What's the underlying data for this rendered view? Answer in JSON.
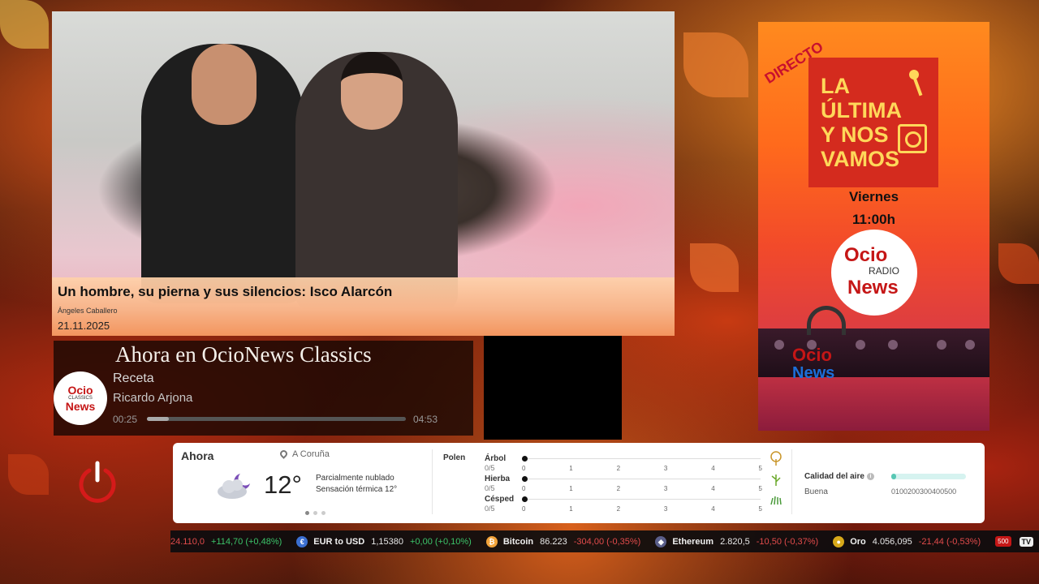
{
  "featured": {
    "title": "Un hombre, su pierna y sus silencios: Isco Alarcón",
    "author": "Ángeles Caballero",
    "date": "21.11.2025"
  },
  "player": {
    "heading": "Ahora en OcioNews Classics",
    "logo": {
      "top": "Ocio",
      "middle": "CLASSICS",
      "bottom": "News"
    },
    "song": "Receta",
    "artist": "Ricardo Arjona",
    "elapsed": "00:25",
    "duration": "04:53",
    "progress": 0.085
  },
  "radio": {
    "badge": "DIRECTO",
    "show_lines": [
      "LA",
      "ÚLTIMA",
      "Y NOS",
      "VAMOS"
    ],
    "day": "Viernes",
    "time": "11:00h",
    "logo": {
      "top": "Ocio",
      "middle": "RADIO",
      "bottom": "News"
    },
    "corner_logo": {
      "top": "Ocio",
      "bottom": "News"
    }
  },
  "weather": {
    "now_label": "Ahora",
    "location": "A Coruña",
    "temp": "12°",
    "condition": "Parcialmente nublado",
    "feels_like": "Sensación térmica 12°",
    "icon": "partly-cloudy-night-icon",
    "pollen_label": "Polen",
    "pollen": [
      {
        "name": "Árbol",
        "score": "0/5",
        "level": 0,
        "icon": "tree-icon"
      },
      {
        "name": "Hierba",
        "score": "0/5",
        "level": 0,
        "icon": "grass-icon"
      },
      {
        "name": "Césped",
        "score": "0/5",
        "level": 0,
        "icon": "lawn-icon"
      }
    ],
    "pollen_ticks": [
      "0",
      "1",
      "2",
      "3",
      "4",
      "5"
    ],
    "air_label": "Calidad del aire",
    "air_value": "Buena",
    "air_scale": "0100200300400500",
    "air_level_fraction": 0.07
  },
  "ticker": [
    {
      "name": "",
      "value": "24.110,0",
      "change": "+114,70 (+0,48%)",
      "dir": "up",
      "icon": ""
    },
    {
      "name": "EUR to USD",
      "value": "1,15380",
      "change": "+0,00 (+0,10%)",
      "dir": "up",
      "icon": "currency-icon"
    },
    {
      "name": "Bitcoin",
      "value": "86.223",
      "change": "-304,00 (-0,35%)",
      "dir": "down",
      "icon": "bitcoin-icon"
    },
    {
      "name": "Ethereum",
      "value": "2.820,5",
      "change": "-10,50 (-0,37%)",
      "dir": "down",
      "icon": "ethereum-icon"
    },
    {
      "name": "Oro",
      "value": "4.056,095",
      "change": "-21,44 (-0,53%)",
      "dir": "down",
      "icon": "gold-icon"
    }
  ],
  "ticker_badges": {
    "sp": "500",
    "tv": "TV"
  },
  "colors": {
    "accent_red": "#c51616",
    "up": "#3cc46a",
    "down": "#e24b4b",
    "air_good": "#58c7b4"
  }
}
